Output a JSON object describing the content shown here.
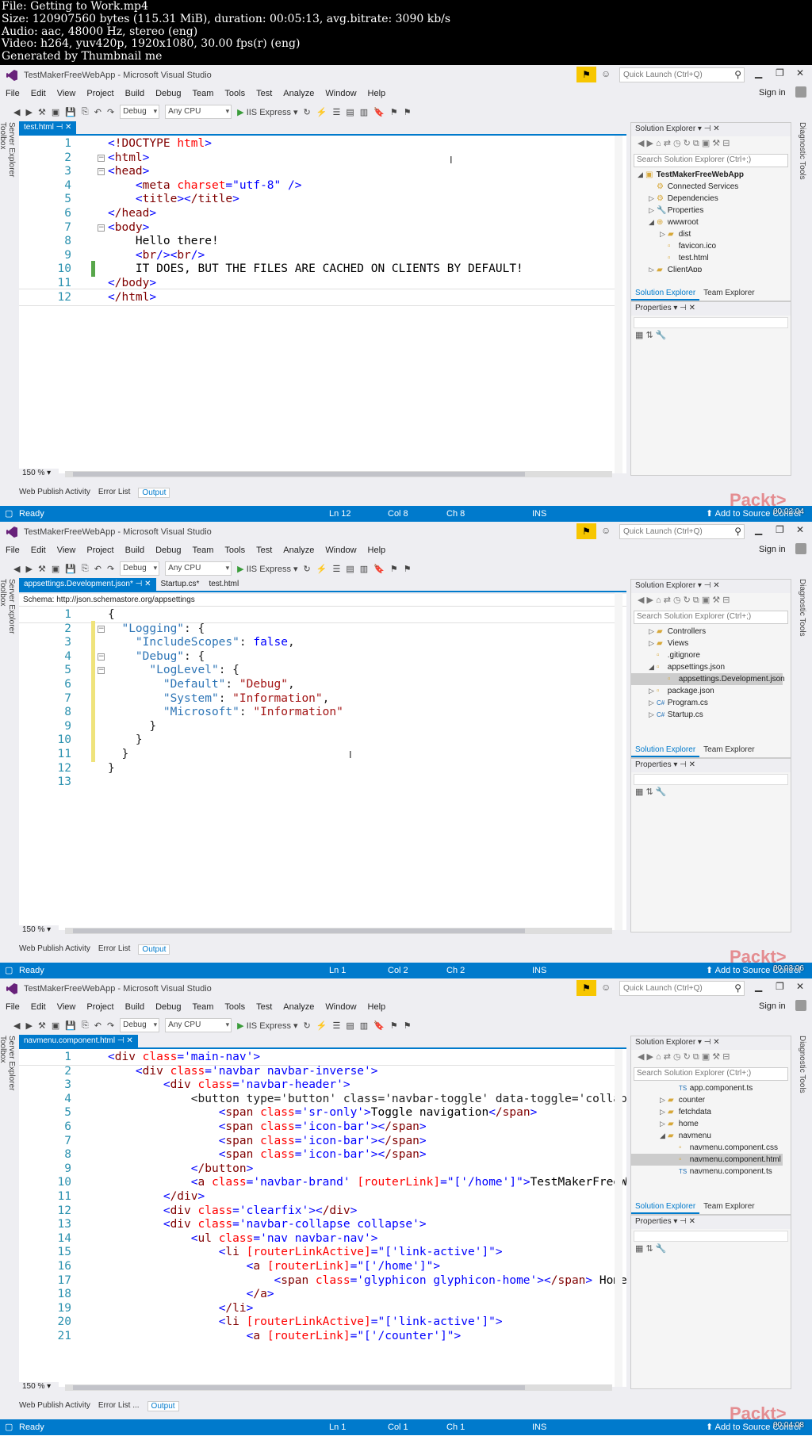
{
  "meta": {
    "lines": [
      "File: Getting to Work.mp4",
      "Size: 120907560 bytes (115.31 MiB), duration: 00:05:13, avg.bitrate: 3090 kb/s",
      "Audio: aac, 48000 Hz, stereo (eng)",
      "Video: h264, yuv420p, 1920x1080, 30.00 fps(r) (eng)",
      "Generated by Thumbnail me"
    ]
  },
  "window": {
    "title": "TestMakerFreeWebApp - Microsoft Visual Studio",
    "quick_launch": "Quick Launch (Ctrl+Q)",
    "sign_in": "Sign in"
  },
  "menu": [
    "File",
    "Edit",
    "View",
    "Project",
    "Build",
    "Debug",
    "Team",
    "Tools",
    "Test",
    "Analyze",
    "Window",
    "Help"
  ],
  "toolbar": {
    "config": "Debug",
    "platform": "Any CPU",
    "run": "IIS Express"
  },
  "side_left": [
    "Server Explorer",
    "Toolbox"
  ],
  "side_right": "Diagnostic Tools",
  "frames": [
    {
      "tabs": [
        "test.html"
      ],
      "schema": "",
      "lines": [
        "<!DOCTYPE html>",
        "<html>",
        "<head>",
        "    <meta charset=\"utf-8\" />",
        "    <title></title>",
        "</head>",
        "<body>",
        "    Hello there!",
        "    <br/><br/>",
        "    IT DOES, BUT THE FILES ARE CACHED ON CLIENTS BY DEFAULT!",
        "</body>",
        "</html>"
      ],
      "zoom": "150 %",
      "status": {
        "state": "Ready",
        "ln": "Ln 12",
        "col": "Col 8",
        "ch": "Ch 8",
        "ins": "INS",
        "right": "Add to Source Control"
      },
      "timestamp": "00:02:04",
      "tree": [
        {
          "label": "TestMakerFreeWebApp",
          "level": 0,
          "tw": "◢",
          "ic": "▣",
          "bold": true
        },
        {
          "label": "Connected Services",
          "level": 1,
          "tw": "",
          "ic": "⚙"
        },
        {
          "label": "Dependencies",
          "level": 1,
          "tw": "▷",
          "ic": "⚙"
        },
        {
          "label": "Properties",
          "level": 1,
          "tw": "▷",
          "ic": "🔧"
        },
        {
          "label": "wwwroot",
          "level": 1,
          "tw": "◢",
          "ic": "⊕"
        },
        {
          "label": "dist",
          "level": 2,
          "tw": "▷",
          "ic": "▰"
        },
        {
          "label": "favicon.ico",
          "level": 2,
          "tw": "",
          "ic": "▫"
        },
        {
          "label": "test.html",
          "level": 2,
          "tw": "",
          "ic": "▫"
        },
        {
          "label": "ClientApp",
          "level": 1,
          "tw": "▷",
          "ic": "▰"
        }
      ]
    },
    {
      "tabs": [
        "appsettings.Development.json*",
        "Startup.cs*",
        "test.html"
      ],
      "schema": "Schema:  http://json.schemastore.org/appsettings",
      "lines": [
        "{",
        "  \"Logging\": {",
        "    \"IncludeScopes\": false,",
        "    \"Debug\": {",
        "      \"LogLevel\": {",
        "        \"Default\": \"Debug\",",
        "        \"System\": \"Information\",",
        "        \"Microsoft\": \"Information\"",
        "      }",
        "    }",
        "  }",
        "}",
        ""
      ],
      "zoom": "150 %",
      "status": {
        "state": "Ready",
        "ln": "Ln 1",
        "col": "Col 2",
        "ch": "Ch 2",
        "ins": "INS",
        "right": "Add to Source Control"
      },
      "timestamp": "00:03:06",
      "tree": [
        {
          "label": "Controllers",
          "level": 1,
          "tw": "▷",
          "ic": "▰"
        },
        {
          "label": "Views",
          "level": 1,
          "tw": "▷",
          "ic": "▰"
        },
        {
          "label": ".gitignore",
          "level": 1,
          "tw": "",
          "ic": "▫"
        },
        {
          "label": "appsettings.json",
          "level": 1,
          "tw": "◢",
          "ic": "▫"
        },
        {
          "label": "appsettings.Development.json",
          "level": 2,
          "tw": "",
          "ic": "▫",
          "sel": true
        },
        {
          "label": "package.json",
          "level": 1,
          "tw": "▷",
          "ic": "▫"
        },
        {
          "label": "Program.cs",
          "level": 1,
          "tw": "▷",
          "ic": "C#"
        },
        {
          "label": "Startup.cs",
          "level": 1,
          "tw": "▷",
          "ic": "C#"
        }
      ]
    },
    {
      "tabs": [
        "navmenu.component.html"
      ],
      "schema": "",
      "lines": [
        "<div class='main-nav'>",
        "    <div class='navbar navbar-inverse'>",
        "        <div class='navbar-header'>",
        "            <button type='button' class='navbar-toggle' data-toggle='collapse'",
        "                <span class='sr-only'>Toggle navigation</span>",
        "                <span class='icon-bar'></span>",
        "                <span class='icon-bar'></span>",
        "                <span class='icon-bar'></span>",
        "            </button>",
        "            <a class='navbar-brand' [routerLink]=\"['/home']\">TestMakerFreeWebApp",
        "        </div>",
        "        <div class='clearfix'></div>",
        "        <div class='navbar-collapse collapse'>",
        "            <ul class='nav navbar-nav'>",
        "                <li [routerLinkActive]=\"['link-active']\">",
        "                    <a [routerLink]=\"['/home']\">",
        "                        <span class='glyphicon glyphicon-home'></span> Home",
        "                    </a>",
        "                </li>",
        "                <li [routerLinkActive]=\"['link-active']\">",
        "                    <a [routerLink]=\"['/counter']\">"
      ],
      "zoom": "150 %",
      "status": {
        "state": "Ready",
        "ln": "Ln 1",
        "col": "Col 1",
        "ch": "Ch 1",
        "ins": "INS",
        "right": "Add to Source Control"
      },
      "timestamp": "00:04:08",
      "tree": [
        {
          "label": "app.component.ts",
          "level": 3,
          "tw": "",
          "ic": "TS"
        },
        {
          "label": "counter",
          "level": 2,
          "tw": "▷",
          "ic": "▰"
        },
        {
          "label": "fetchdata",
          "level": 2,
          "tw": "▷",
          "ic": "▰"
        },
        {
          "label": "home",
          "level": 2,
          "tw": "▷",
          "ic": "▰"
        },
        {
          "label": "navmenu",
          "level": 2,
          "tw": "◢",
          "ic": "▰"
        },
        {
          "label": "navmenu.component.css",
          "level": 3,
          "tw": "",
          "ic": "▫"
        },
        {
          "label": "navmenu.component.html",
          "level": 3,
          "tw": "",
          "ic": "▫",
          "sel": true
        },
        {
          "label": "navmenu.component.ts",
          "level": 3,
          "tw": "",
          "ic": "TS"
        }
      ]
    }
  ],
  "panels": {
    "solution_explorer": "Solution Explorer",
    "search": "Search Solution Explorer (Ctrl+;)",
    "team_explorer": "Team Explorer",
    "properties": "Properties",
    "output_tabs": [
      "Web Publish Activity",
      "Error List",
      "Output"
    ],
    "output_tab3": [
      "Web Publish Activity",
      "Error List ...",
      "Output"
    ]
  },
  "brand": "Packt>"
}
